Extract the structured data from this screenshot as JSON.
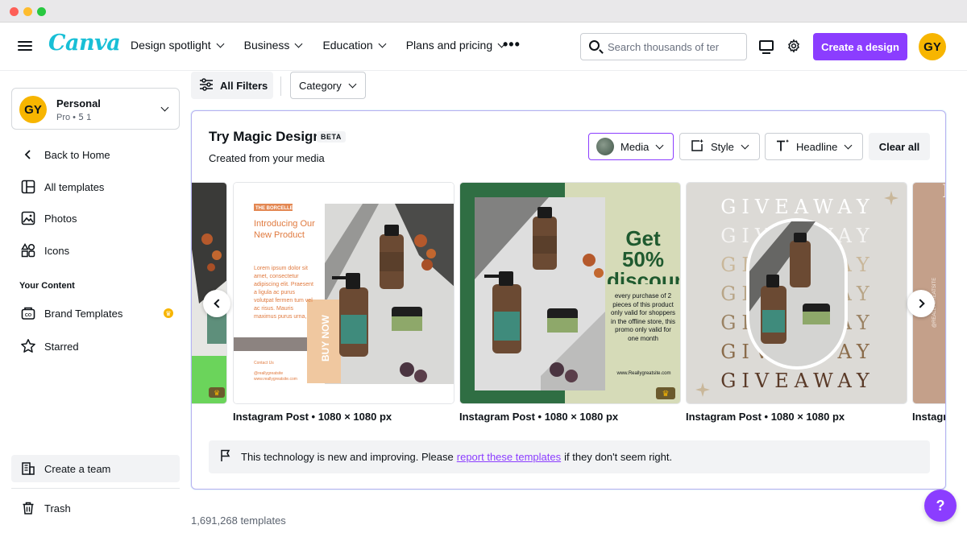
{
  "nav": {
    "logo": "Canva",
    "links": [
      "Design spotlight",
      "Business",
      "Education",
      "Plans and pricing"
    ],
    "more": "•••",
    "search_placeholder": "Search thousands of ter",
    "create_label": "Create a design",
    "avatar_initials": "GY"
  },
  "sidebar": {
    "account": {
      "initials": "GY",
      "name": "Personal",
      "sub": "Pro • 𝟧 1"
    },
    "items": [
      "Back to Home",
      "All templates",
      "Photos",
      "Icons"
    ],
    "heading": "Your Content",
    "content_items": [
      "Brand Templates",
      "Starred"
    ],
    "team": "Create a team",
    "trash": "Trash"
  },
  "filters": {
    "all_label": "All Filters",
    "category_label": "Category"
  },
  "magic": {
    "title": "Try Magic Design",
    "badge": "BETA",
    "subtitle": "Created from your media",
    "media_label": "Media",
    "style_label": "Style",
    "headline_label": "Headline",
    "clear_label": "Clear all"
  },
  "cards": [
    {
      "label": "Instagram Post • 1080 × 1080 px",
      "brand": "THE BORCELLE",
      "heading": "Introducing Our New Product",
      "body": "Lorem ipsum dolor sit amet, consectetur adipiscing elit. Praesent a ligula ac purus volutpat fermen tum vel ac risus. Mauris maximus purus urna,",
      "cta": "BUY NOW",
      "contact": "Contact Us",
      "handle": "@reallygreatsite",
      "site": "www.reallygreatsite.com"
    },
    {
      "label": "Instagram Post • 1080 × 1080 px",
      "headline": "Get 50% discount",
      "body": "every purchase of 2 pieces of this product only valid for shoppers in the offline store, this promo only valid for one month",
      "site": "www.Reallygreatsite.com"
    },
    {
      "label": "Instagram Post • 1080 × 1080 px",
      "word": "GIVEAWAY"
    },
    {
      "label": "Instagr",
      "side_text": "@REALLYGREATSITE"
    }
  ],
  "notice": {
    "before": "This technology is new and improving. Please",
    "link": "report these templates",
    "after": "if they don't seem right."
  },
  "count": "1,691,268 templates",
  "help": "?",
  "colors": {
    "accent": "#8b3dff",
    "logo_teal": "#18bfd6",
    "avatar": "#f7b500"
  }
}
